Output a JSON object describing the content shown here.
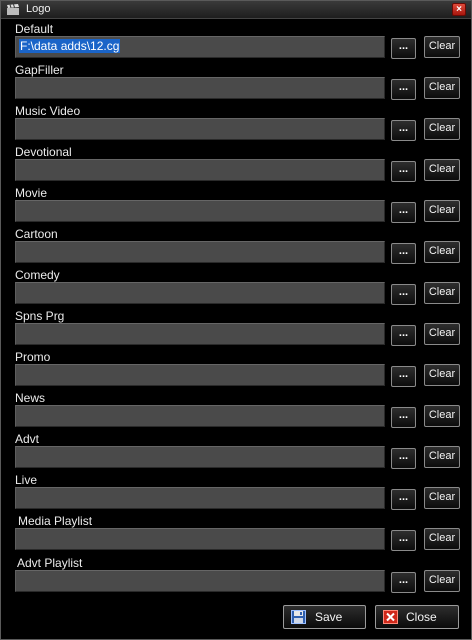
{
  "window": {
    "title": "Logo",
    "close_glyph": "×",
    "icon": "clapperboard-icon"
  },
  "browse_label": "...",
  "clear_label": "Clear",
  "rows": [
    {
      "label": "Default",
      "value": "F:\\data adds\\12.cg",
      "selected": true
    },
    {
      "label": "GapFiller",
      "value": ""
    },
    {
      "label": "Music Video",
      "value": ""
    },
    {
      "label": "Devotional",
      "value": ""
    },
    {
      "label": "Movie",
      "value": ""
    },
    {
      "label": "Cartoon",
      "value": ""
    },
    {
      "label": "Comedy",
      "value": ""
    },
    {
      "label": "Spns Prg",
      "value": ""
    },
    {
      "label": "Promo",
      "value": ""
    },
    {
      "label": "News",
      "value": ""
    },
    {
      "label": "Advt",
      "value": ""
    },
    {
      "label": "Live",
      "value": ""
    },
    {
      "label": "Media Playlist",
      "value": ""
    },
    {
      "label": "Advt Playlist",
      "value": ""
    }
  ],
  "footer": {
    "save_label": "Save",
    "save_icon": "floppy-disk-icon",
    "close_label": "Close",
    "close_icon": "close-x-icon"
  },
  "colors": {
    "background": "#000000",
    "field": "#4a4a4a",
    "selection": "#1a64c8",
    "close_red": "#d0281a"
  }
}
